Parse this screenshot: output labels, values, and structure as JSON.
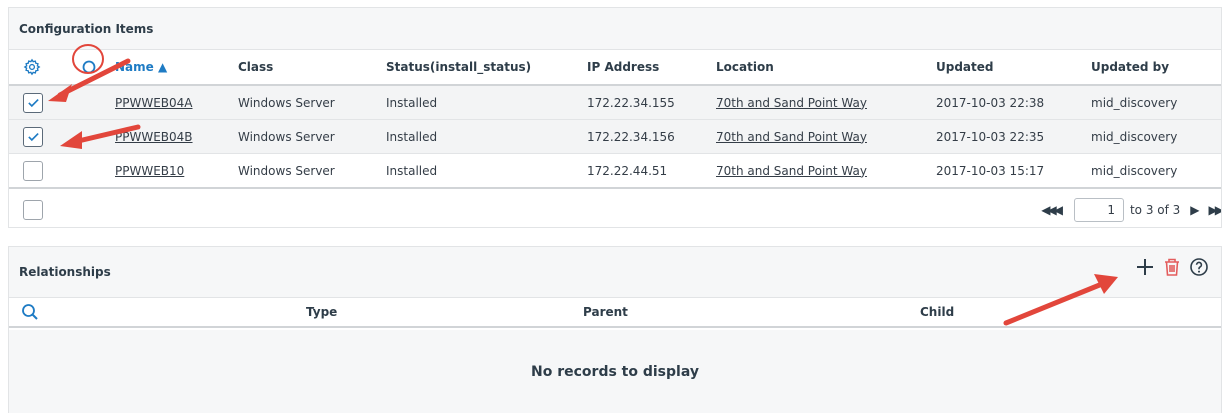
{
  "ci": {
    "title": "Configuration Items",
    "columns": [
      "Name ▲",
      "Class",
      "Status(install_status)",
      "IP Address",
      "Location",
      "Updated",
      "Updated by"
    ],
    "rows": [
      {
        "name": "PPWWEB04A",
        "class": "Windows Server",
        "status": "Installed",
        "ip": "172.22.34.155",
        "location": "70th and Sand Point Way",
        "updated": "2017-10-03 22:38",
        "updated_by": "mid_discovery",
        "checked": true
      },
      {
        "name": "PPWWEB04B",
        "class": "Windows Server",
        "status": "Installed",
        "ip": "172.22.34.156",
        "location": "70th and Sand Point Way",
        "updated": "2017-10-03 22:35",
        "updated_by": "mid_discovery",
        "checked": true
      },
      {
        "name": "PPWWEB10",
        "class": "Windows Server",
        "status": "Installed",
        "ip": "172.22.44.51",
        "location": "70th and Sand Point Way",
        "updated": "2017-10-03 15:17",
        "updated_by": "mid_discovery",
        "checked": false
      }
    ],
    "pager": {
      "first_label": "◀◀◀",
      "page": "1",
      "range": "to 3 of 3",
      "next_label": "▶",
      "last_label": "▶▶"
    }
  },
  "rel": {
    "title": "Relationships",
    "columns": [
      "Type",
      "Parent",
      "Child"
    ],
    "empty": "No records to display"
  },
  "colors": {
    "accent": "#1e7bc4",
    "annotation": "#e2463b",
    "delete": "#e35d5d"
  }
}
